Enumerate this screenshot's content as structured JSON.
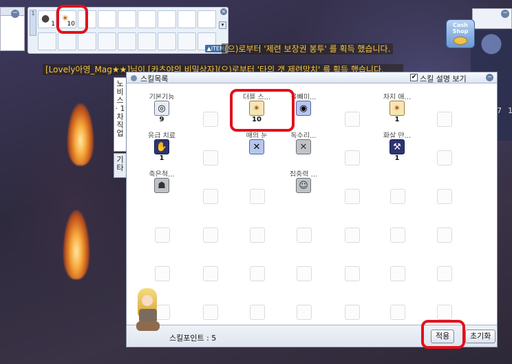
{
  "hotkey": {
    "row_number": "1",
    "slots": [
      {
        "icon": "stone-icon",
        "count": "1"
      },
      {
        "icon": "double-strafe-icon",
        "count": "10"
      },
      {
        "icon": "",
        "count": ""
      },
      {
        "icon": "",
        "count": ""
      },
      {
        "icon": "",
        "count": ""
      },
      {
        "icon": "",
        "count": ""
      },
      {
        "icon": "",
        "count": ""
      },
      {
        "icon": "",
        "count": ""
      },
      {
        "icon": "",
        "count": ""
      }
    ],
    "tag": "▲ITEM",
    "close": "×",
    "scroll": "▾"
  },
  "cash_shop": {
    "label_line1": "Cash",
    "label_line2": "Shop"
  },
  "chat": [
    {
      "text": "(으)로부터 '제련 보장권 봉투' 를 획득 했습니다."
    },
    {
      "text": "[Lovely아영_Mag★★]님이 [카츠야의 비밀상자](으)로부터 '타의 갯 제련망치' 를 획득 했습니다."
    }
  ],
  "skill_window": {
    "title": "스킬목록",
    "desc_checkbox_label": "스킬 설명 보기",
    "desc_checked": "✔",
    "tabs": [
      "노비스 · 1차직업",
      "기타"
    ],
    "skills": [
      {
        "name": "기본기능",
        "level": "9",
        "icon": "basic-skill-icon",
        "glyph": "◎",
        "style": ""
      },
      {
        "name": "더블 스...",
        "level": "10",
        "icon": "double-strafe-icon",
        "glyph": "✴",
        "style": "gold"
      },
      {
        "name": "올빼미...",
        "level": "",
        "icon": "owl-eye-icon",
        "glyph": "◉",
        "style": "blue"
      },
      {
        "name": "차지 애...",
        "level": "1",
        "icon": "charge-arrow-icon",
        "glyph": "✴",
        "style": "gold"
      },
      {
        "name": "응급 치료",
        "level": "1",
        "icon": "first-aid-icon",
        "glyph": "✋",
        "style": "dark"
      },
      {
        "name": "매의 눈",
        "level": "",
        "icon": "vultures-eye-icon",
        "glyph": "✕",
        "style": "blue"
      },
      {
        "name": "독수리...",
        "level": "",
        "icon": "eagle-eye-icon",
        "glyph": "✕",
        "style": "grey"
      },
      {
        "name": "화살 만...",
        "level": "1",
        "icon": "arrow-crafting-icon",
        "glyph": "⚒",
        "style": "dark"
      },
      {
        "name": "죽은척...",
        "level": "",
        "icon": "play-dead-icon",
        "glyph": "☗",
        "style": "grey"
      },
      {
        "name": "집중력 ...",
        "level": "",
        "icon": "improve-concentration-icon",
        "glyph": "☺",
        "style": "grey"
      }
    ],
    "skill_points_label": "스킬포인트 : 5",
    "apply_button": "적용",
    "reset_button": "초기화"
  },
  "edge_numbers": [
    "7",
    "1"
  ],
  "colors": {
    "highlight": "#e0111b",
    "chat_text": "#f6c34a"
  }
}
